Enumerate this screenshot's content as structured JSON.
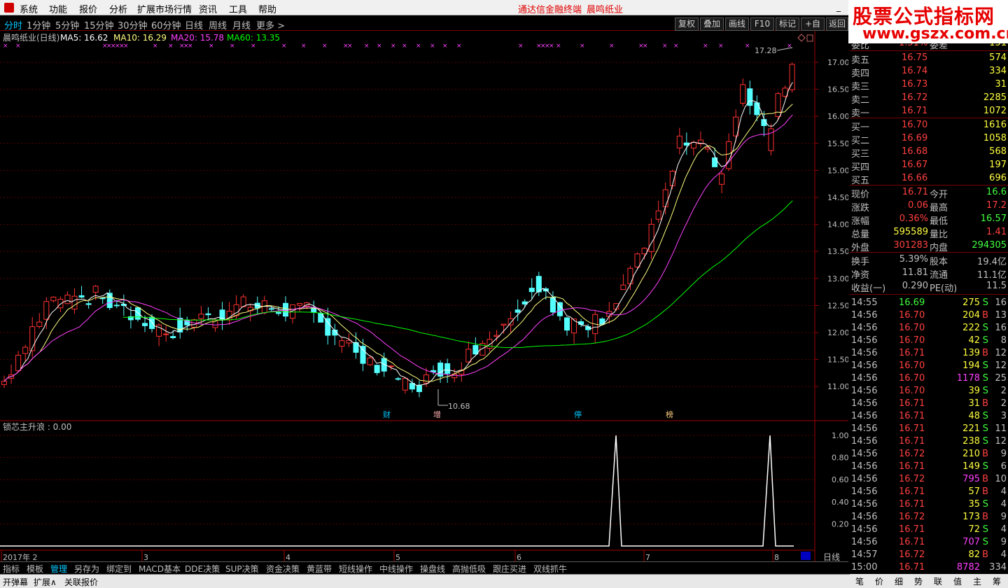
{
  "menu": [
    "系统",
    "功能",
    "报价",
    "分析",
    "扩展市场行情",
    "资讯",
    "工具",
    "帮助"
  ],
  "app_title": "通达信金融终端",
  "stock_title": "晨鸣纸业",
  "watermark": {
    "line1": "股票公式指标网",
    "line2": "www.gszx.com.cn"
  },
  "periods": [
    "分时",
    "1分钟",
    "5分钟",
    "15分钟",
    "30分钟",
    "60分钟",
    "日线",
    "周线",
    "月线",
    "更多 >"
  ],
  "tools": [
    "复权",
    "叠加",
    "画线",
    "F10",
    "标记",
    "+自选",
    "返回"
  ],
  "ma_legend": {
    "name": "晨鸣纸业(日线)",
    "ma5": "MA5: 16.62",
    "ma10": "MA10: 16.29",
    "ma20": "MA20: 15.78",
    "ma60": "MA60: 13.35",
    "colors": {
      "ma5": "#ffffff",
      "ma10": "#ffff80",
      "ma20": "#ff40ff",
      "ma60": "#00ff00"
    }
  },
  "price_axis": [
    "17.00",
    "16.50",
    "16.00",
    "15.50",
    "15.00",
    "14.50",
    "14.00",
    "13.50",
    "13.00",
    "12.50",
    "12.00",
    "11.50",
    "11.00"
  ],
  "annotations": {
    "high": "17.28",
    "low": "10.68",
    "events": [
      "财",
      "增",
      "停",
      "榜"
    ]
  },
  "indicator": {
    "label": "锁芯主升浪 : 0.00",
    "axis": [
      "1.00",
      "0.80",
      "0.60",
      "0.40",
      "0.20"
    ]
  },
  "date_axis": [
    "2017年 2",
    "3",
    "4",
    "5",
    "6",
    "7",
    "8"
  ],
  "period_label": "日线",
  "chart_data": {
    "type": "candlestick",
    "ylim": [
      10.5,
      17.3
    ],
    "high": 17.28,
    "low": 10.68,
    "indicator_peaks": [
      {
        "month": "7",
        "value": 1.0
      },
      {
        "month": "8",
        "value": 1.0
      }
    ]
  },
  "orderbook": {
    "ratio": {
      "label": "委比",
      "value": "1.51%",
      "extra_label": "委差",
      "extra": "151"
    },
    "asks": [
      {
        "label": "卖五",
        "price": "16.75",
        "vol": "574"
      },
      {
        "label": "卖四",
        "price": "16.74",
        "vol": "334"
      },
      {
        "label": "卖三",
        "price": "16.73",
        "vol": "31"
      },
      {
        "label": "卖二",
        "price": "16.72",
        "vol": "2285"
      },
      {
        "label": "卖一",
        "price": "16.71",
        "vol": "1072"
      }
    ],
    "bids": [
      {
        "label": "买一",
        "price": "16.70",
        "vol": "1616"
      },
      {
        "label": "买二",
        "price": "16.69",
        "vol": "1058"
      },
      {
        "label": "买三",
        "price": "16.68",
        "vol": "568"
      },
      {
        "label": "买四",
        "price": "16.67",
        "vol": "197"
      },
      {
        "label": "买五",
        "price": "16.66",
        "vol": "696"
      }
    ]
  },
  "stats": [
    {
      "l1": "现价",
      "v1": "16.71",
      "c1": "#ff4040",
      "l2": "今开",
      "v2": "16.6",
      "c2": "#40ff40"
    },
    {
      "l1": "涨跌",
      "v1": "0.06",
      "c1": "#ff4040",
      "l2": "最高",
      "v2": "17.2",
      "c2": "#ff4040"
    },
    {
      "l1": "涨幅",
      "v1": "0.36%",
      "c1": "#ff4040",
      "l2": "最低",
      "v2": "16.57",
      "c2": "#40ff40"
    },
    {
      "l1": "总量",
      "v1": "595589",
      "c1": "#ffff40",
      "l2": "量比",
      "v2": "1.41",
      "c2": "#ff4040"
    },
    {
      "l1": "外盘",
      "v1": "301283",
      "c1": "#ff4040",
      "l2": "内盘",
      "v2": "294305",
      "c2": "#40ff40"
    }
  ],
  "fundamentals": [
    {
      "l1": "换手",
      "v1": "5.39%",
      "l2": "股本",
      "v2": "19.4亿"
    },
    {
      "l1": "净资",
      "v1": "11.81",
      "l2": "流通",
      "v2": "11.1亿"
    },
    {
      "l1": "收益(一)",
      "v1": "0.290",
      "l2": "PE(动)",
      "v2": "11.5"
    }
  ],
  "ticks": [
    {
      "t": "14:55",
      "p": "16.69",
      "v": "275",
      "bs": "S",
      "n": "16"
    },
    {
      "t": "14:56",
      "p": "16.70",
      "v": "204",
      "bs": "B",
      "n": "13"
    },
    {
      "t": "14:56",
      "p": "16.70",
      "v": "222",
      "bs": "S",
      "n": "16"
    },
    {
      "t": "14:56",
      "p": "16.70",
      "v": "42",
      "bs": "S",
      "n": "8"
    },
    {
      "t": "14:56",
      "p": "16.71",
      "v": "139",
      "bs": "B",
      "n": "12"
    },
    {
      "t": "14:56",
      "p": "16.70",
      "v": "194",
      "bs": "S",
      "n": "12"
    },
    {
      "t": "14:56",
      "p": "16.70",
      "v": "1178",
      "bs": "S",
      "n": "25"
    },
    {
      "t": "14:56",
      "p": "16.70",
      "v": "39",
      "bs": "S",
      "n": "2"
    },
    {
      "t": "14:56",
      "p": "16.71",
      "v": "31",
      "bs": "B",
      "n": "2"
    },
    {
      "t": "14:56",
      "p": "16.71",
      "v": "48",
      "bs": "S",
      "n": "3"
    },
    {
      "t": "14:56",
      "p": "16.71",
      "v": "221",
      "bs": "S",
      "n": "11"
    },
    {
      "t": "14:56",
      "p": "16.71",
      "v": "238",
      "bs": "S",
      "n": "12"
    },
    {
      "t": "14:56",
      "p": "16.72",
      "v": "210",
      "bs": "B",
      "n": "9"
    },
    {
      "t": "14:56",
      "p": "16.71",
      "v": "149",
      "bs": "S",
      "n": "6"
    },
    {
      "t": "14:56",
      "p": "16.72",
      "v": "795",
      "bs": "B",
      "n": "10"
    },
    {
      "t": "14:56",
      "p": "16.71",
      "v": "57",
      "bs": "B",
      "n": "4"
    },
    {
      "t": "14:56",
      "p": "16.71",
      "v": "35",
      "bs": "S",
      "n": "4"
    },
    {
      "t": "14:56",
      "p": "16.72",
      "v": "173",
      "bs": "B",
      "n": "9"
    },
    {
      "t": "14:56",
      "p": "16.71",
      "v": "72",
      "bs": "S",
      "n": "4"
    },
    {
      "t": "14:56",
      "p": "16.71",
      "v": "707",
      "bs": "S",
      "n": "9"
    },
    {
      "t": "14:57",
      "p": "16.72",
      "v": "82",
      "bs": "B",
      "n": "4"
    },
    {
      "t": "15:00",
      "p": "16.71",
      "v": "8782",
      "bs": "",
      "n": "334"
    }
  ],
  "tabs": [
    "指标",
    "模板",
    "管理",
    "另存为",
    "绑定到",
    "MACD基本",
    "DDE决策",
    "SUP决策",
    "资金决策",
    "黄蓝带",
    "短线操作",
    "中线操作",
    "操盘线",
    "高抛低吸",
    "跟庄买进",
    "双线抓牛"
  ],
  "status": [
    "开弹幕",
    "扩展∧",
    "关联报价"
  ],
  "right_tabs": [
    "笔",
    "价",
    "细",
    "势",
    "联",
    "值",
    "主",
    "筹"
  ]
}
